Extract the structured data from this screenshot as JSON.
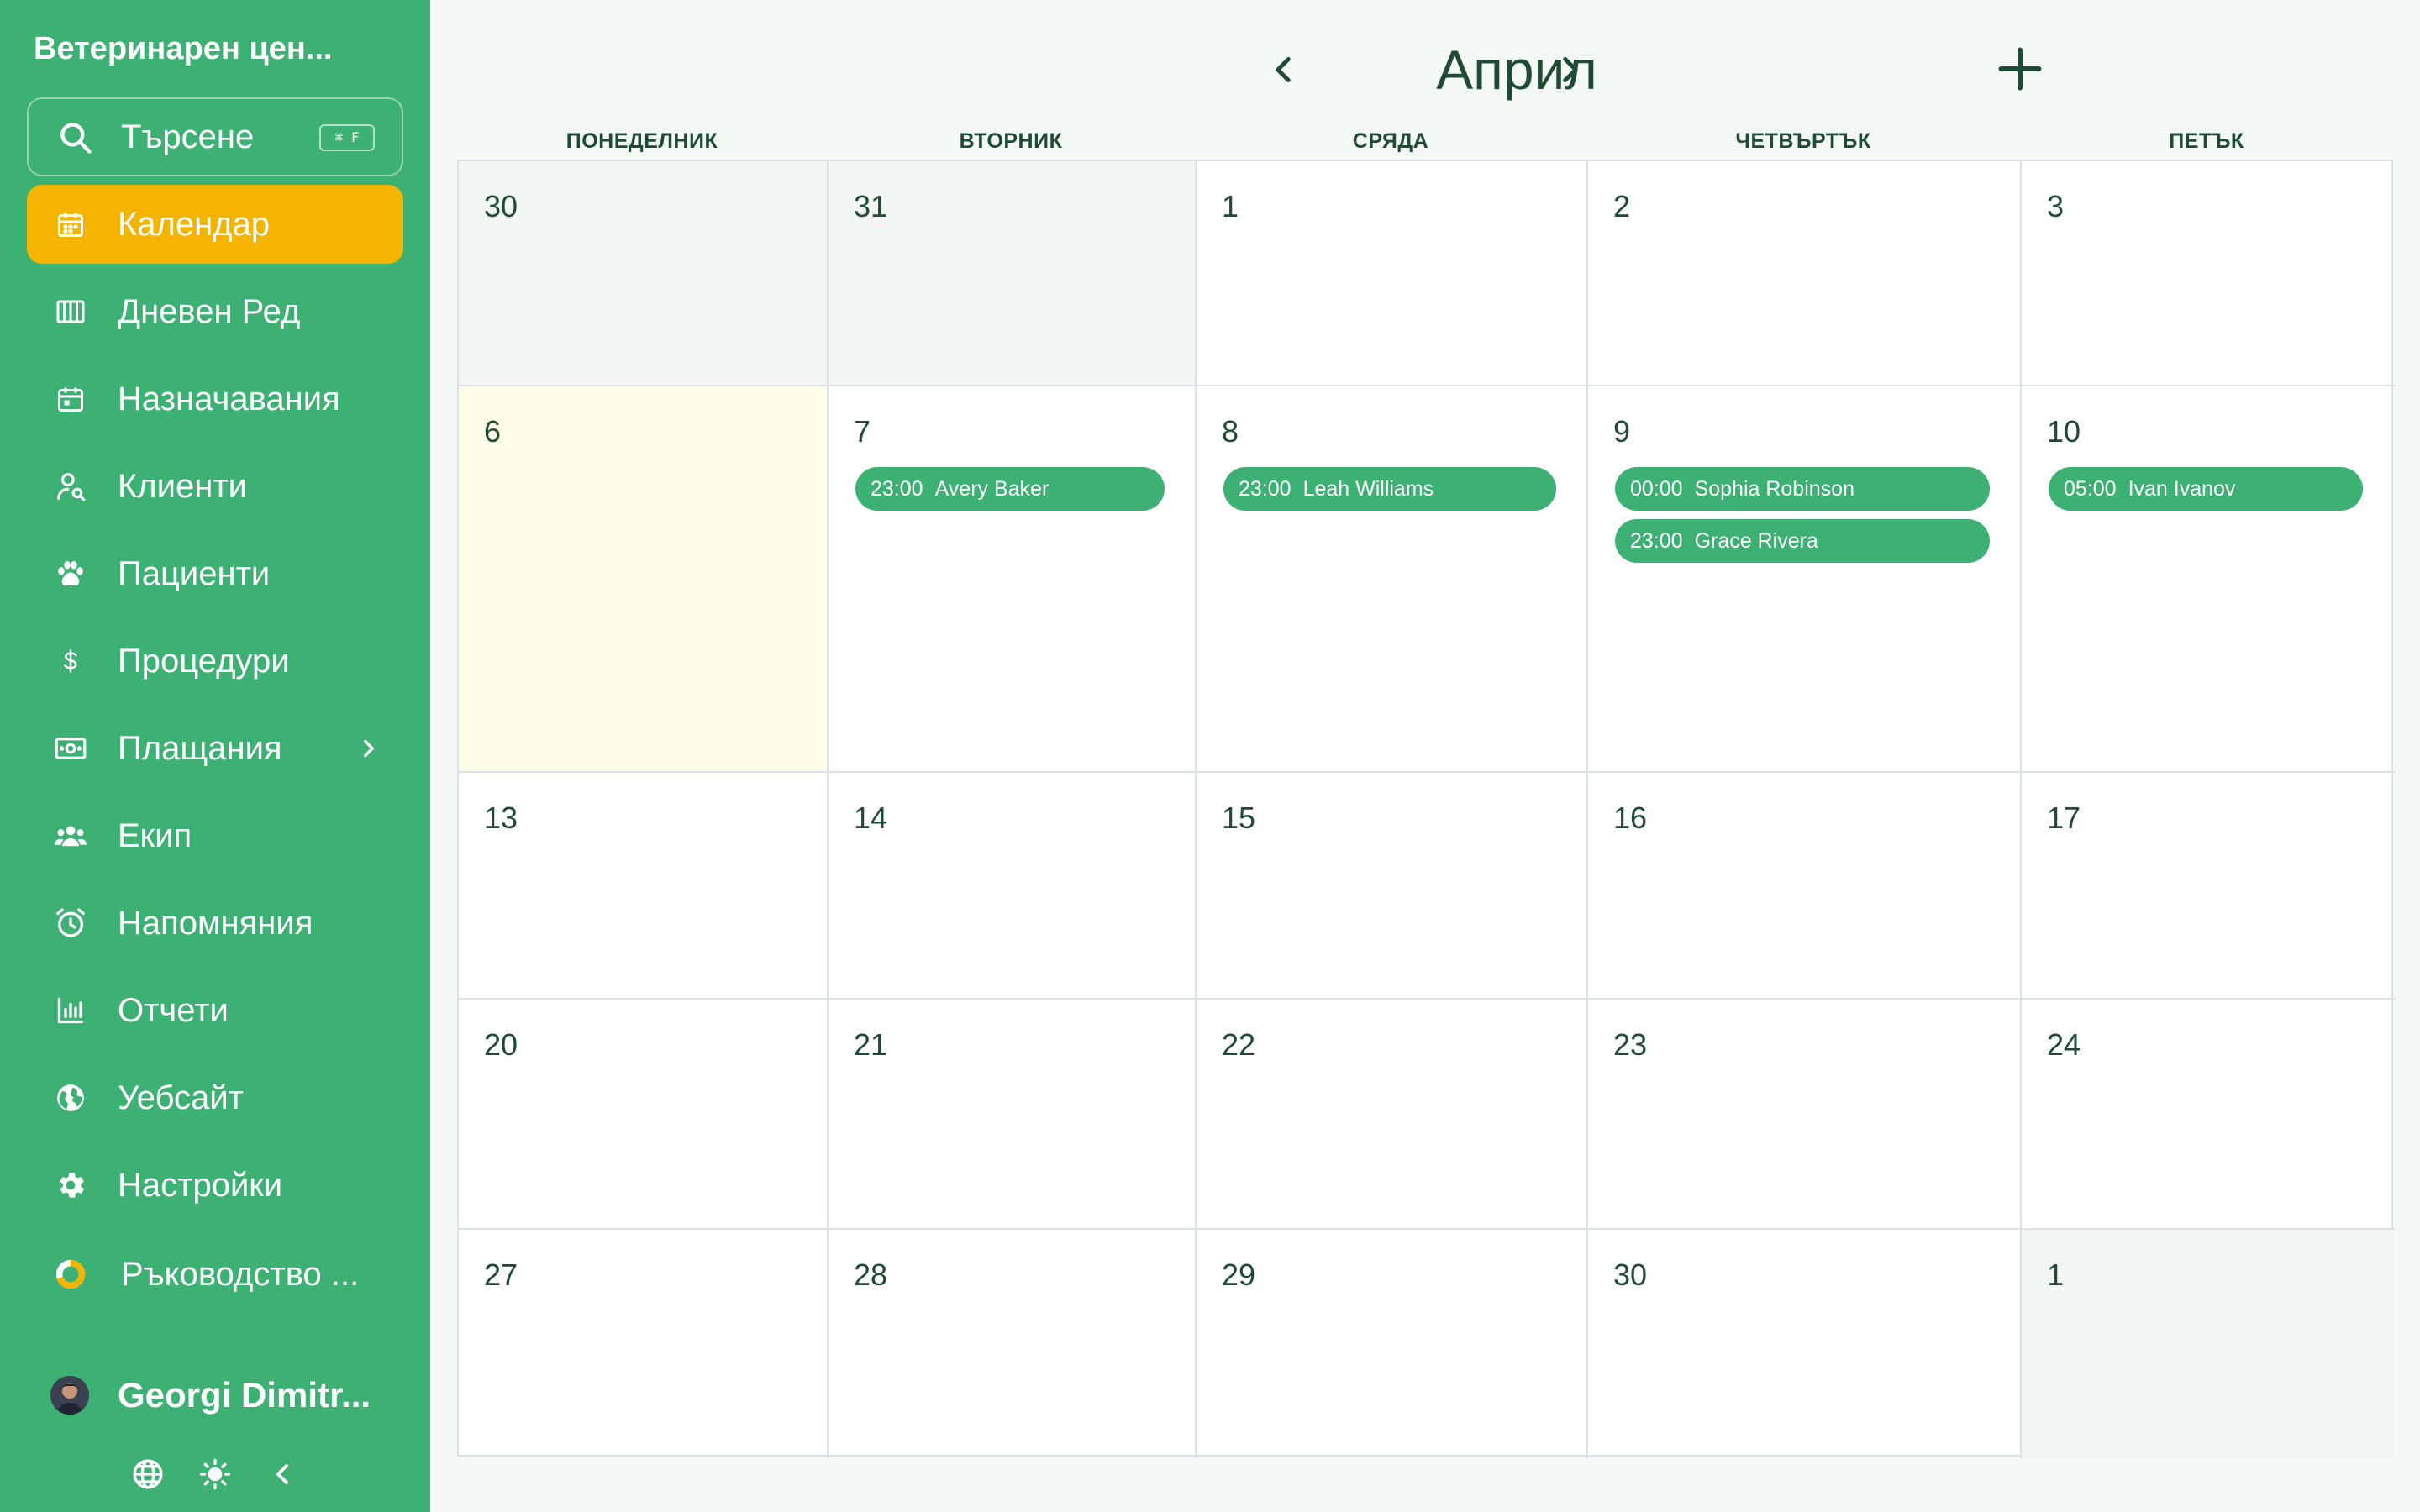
{
  "sidebar": {
    "brand": "Ветеринарен цен...",
    "search": {
      "label": "Търсене",
      "shortcut": "⌘ F"
    },
    "items": [
      {
        "label": "Календар",
        "icon": "calendar-icon"
      },
      {
        "label": "Дневен Ред",
        "icon": "columns-icon"
      },
      {
        "label": "Назначавания",
        "icon": "calendar-event-icon"
      },
      {
        "label": "Клиенти",
        "icon": "user-search-icon"
      },
      {
        "label": "Пациенти",
        "icon": "paw-icon"
      },
      {
        "label": "Процедури",
        "icon": "dollar-icon"
      },
      {
        "label": "Плащания",
        "icon": "cash-icon"
      },
      {
        "label": "Екип",
        "icon": "team-icon"
      },
      {
        "label": "Напомняния",
        "icon": "alarm-icon"
      },
      {
        "label": "Отчети",
        "icon": "bar-chart-icon"
      },
      {
        "label": "Уебсайт",
        "icon": "globe-icon"
      },
      {
        "label": "Настройки",
        "icon": "gear-icon"
      },
      {
        "label": "Ръководство ...",
        "icon": "progress-ring-icon"
      }
    ],
    "user": {
      "name": "Georgi Dimitr..."
    }
  },
  "calendar": {
    "month": "Април",
    "weekdays": [
      "ПОНЕДЕЛНИК",
      "ВТОРНИК",
      "СРЯДА",
      "ЧЕТВЪРТЪК",
      "ПЕТЪК"
    ],
    "weeks": [
      [
        {
          "d": "30",
          "other": true
        },
        {
          "d": "31",
          "other": true
        },
        {
          "d": "1"
        },
        {
          "d": "2"
        },
        {
          "d": "3"
        }
      ],
      [
        {
          "d": "6",
          "today": true
        },
        {
          "d": "7",
          "events": [
            {
              "time": "23:00",
              "name": "Avery Baker"
            }
          ]
        },
        {
          "d": "8",
          "events": [
            {
              "time": "23:00",
              "name": "Leah Williams"
            }
          ]
        },
        {
          "d": "9",
          "events": [
            {
              "time": "00:00",
              "name": "Sophia Robinson"
            },
            {
              "time": "23:00",
              "name": "Grace Rivera"
            }
          ]
        },
        {
          "d": "10",
          "events": [
            {
              "time": "05:00",
              "name": "Ivan Ivanov"
            }
          ]
        }
      ],
      [
        {
          "d": "13"
        },
        {
          "d": "14"
        },
        {
          "d": "15"
        },
        {
          "d": "16"
        },
        {
          "d": "17"
        }
      ],
      [
        {
          "d": "20"
        },
        {
          "d": "21"
        },
        {
          "d": "22"
        },
        {
          "d": "23"
        },
        {
          "d": "24"
        }
      ],
      [
        {
          "d": "27"
        },
        {
          "d": "28"
        },
        {
          "d": "29"
        },
        {
          "d": "30"
        },
        {
          "d": "1",
          "other": true
        }
      ]
    ]
  },
  "colors": {
    "sidebar": "#3db174",
    "active": "#f5b400",
    "event": "#3db174",
    "today": "#fefee8",
    "text": "#1f4a33"
  }
}
